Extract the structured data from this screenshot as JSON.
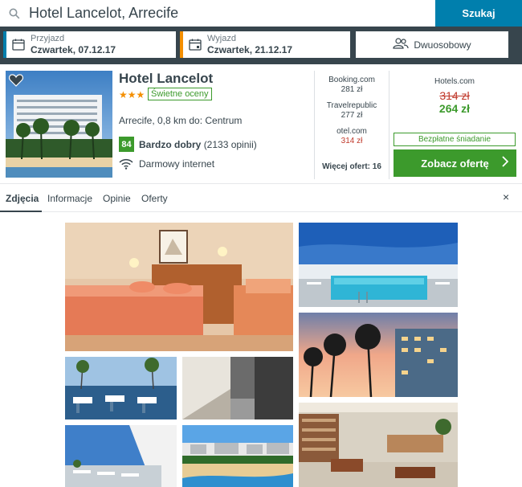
{
  "search": {
    "query": "Hotel Lancelot, Arrecife",
    "button_label": "Szukaj"
  },
  "checkin": {
    "label": "Przyjazd",
    "value": "Czwartek, 07.12.17"
  },
  "checkout": {
    "label": "Wyjazd",
    "value": "Czwartek, 21.12.17"
  },
  "room": {
    "label": "Dwuosobowy"
  },
  "hotel": {
    "name": "Hotel Lancelot",
    "stars": "★★★",
    "rating_badge": "Świetne oceny",
    "location": "Arrecife, 0,8 km do: Centrum",
    "score": "84",
    "score_label": "Bardzo dobry",
    "reviews": "(2133 opinii)",
    "amenity": "Darmowy internet"
  },
  "deals": [
    {
      "site": "Booking.com",
      "price": "281 zł",
      "highlight": false
    },
    {
      "site": "Travelrepublic",
      "price": "277 zł",
      "highlight": false
    },
    {
      "site": "otel.com",
      "price": "314 zł",
      "highlight": true
    }
  ],
  "more_offers": "Więcej ofert: 16",
  "best_offer": {
    "site": "Hotels.com",
    "old_price": "314 zł",
    "price": "264 zł",
    "perk": "Bezpłatne śniadanie",
    "cta": "Zobacz ofertę"
  },
  "tabs": [
    {
      "label": "Zdjęcia",
      "active": true
    },
    {
      "label": "Informacje",
      "active": false
    },
    {
      "label": "Opinie",
      "active": false
    },
    {
      "label": "Oferty",
      "active": false
    }
  ],
  "close_label": "×",
  "colors": {
    "brand_dark": "#37454d",
    "accent_blue": "#007fad",
    "green": "#3c9a2c",
    "orange": "#f48f00",
    "red": "#c0392b"
  },
  "icons": [
    "search-icon",
    "calendar-icon",
    "people-icon",
    "heart-icon",
    "wifi-icon",
    "chevron-right-icon",
    "close-icon"
  ]
}
